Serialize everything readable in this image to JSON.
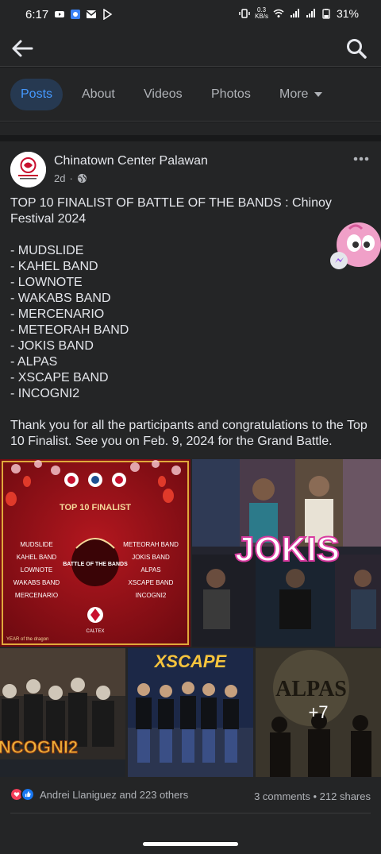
{
  "status": {
    "time": "6:17",
    "net_speed_top": "0.3",
    "net_speed_bottom": "KB/s",
    "battery": "31%"
  },
  "tabs": [
    {
      "label": "Posts",
      "active": true
    },
    {
      "label": "About"
    },
    {
      "label": "Videos"
    },
    {
      "label": "Photos"
    },
    {
      "label": "More"
    }
  ],
  "post": {
    "page_name": "Chinatown Center Palawan",
    "age": "2d",
    "title_line": "TOP 10 FINALIST OF BATTLE OF THE BANDS : Chinoy Festival 2024",
    "bands": [
      "- MUDSLIDE",
      "- KAHEL BAND",
      "- LOWNOTE",
      "- WAKABS BAND",
      "- MERCENARIO",
      "- METEORAH BAND",
      "- JOKIS BAND",
      "- ALPAS",
      "- XSCAPE BAND",
      "- INCOGNI2"
    ],
    "closing": "Thank you for all the participants and congratulations to the Top 10 Finalist. See you on Feb. 9, 2024 for the Grand Battle.",
    "photo_more_count": "+7",
    "reactions_text": "Andrei Llaniguez and 223 others",
    "comments": "3 comments",
    "shares": "212 shares"
  },
  "poster": {
    "heading": "TOP 10 FINALIST",
    "left_list": [
      "MUDSLIDE",
      "KAHEL BAND",
      "LOWNOTE",
      "WAKABS BAND",
      "MERCENARIO"
    ],
    "right_list": [
      "METEORAH BAND",
      "JOKIS BAND",
      "ALPAS",
      "XSCAPE BAND",
      "INCOGNI2"
    ],
    "center_logo": "BATTLE OF THE BANDS",
    "footer": "YEAR of the dragon",
    "sponsor": "CALTEX",
    "jokis": "JOKIS",
    "incogni2": "NCOGNI2",
    "xscape": "XSCAPE",
    "alpas": "ALPAS"
  },
  "colors": {
    "background": "#18191a",
    "surface": "#242526",
    "accent": "#4599ff",
    "text": "#e4e6eb",
    "muted": "#b0b3b8"
  }
}
